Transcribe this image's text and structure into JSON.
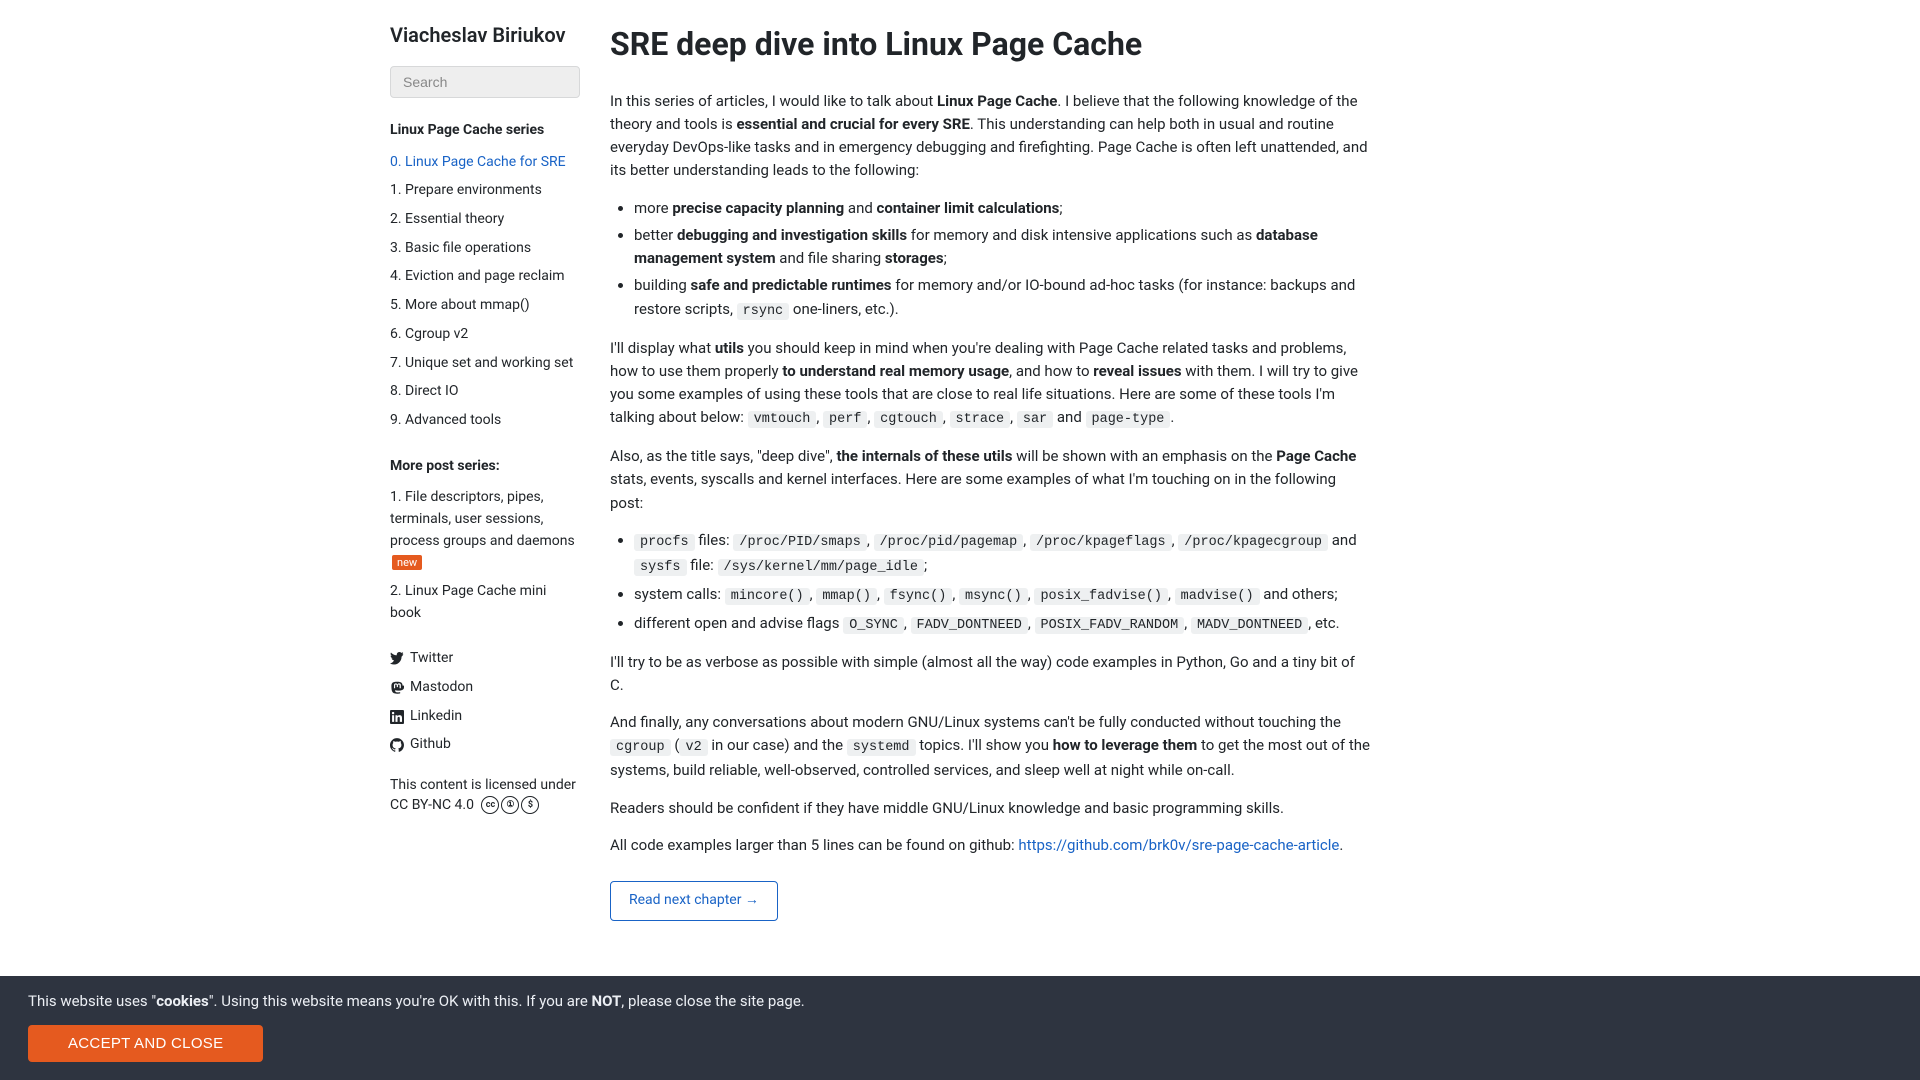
{
  "sidebar": {
    "brand": "Viacheslav Biriukov",
    "search_placeholder": "Search",
    "series_title": "Linux Page Cache series",
    "series": [
      "0. Linux Page Cache for SRE",
      "1. Prepare environments",
      "2. Essential theory",
      "3. Basic file operations",
      "4. Eviction and page reclaim",
      "5. More about mmap()",
      "6. Cgroup v2",
      "7. Unique set and working set",
      "8. Direct IO",
      "9. Advanced tools"
    ],
    "more_title": "More post series:",
    "more": [
      {
        "label": "1. File descriptors, pipes, terminals, user sessions, process groups and daemons",
        "badge": "new"
      },
      {
        "label": "2. Linux Page Cache mini book"
      }
    ],
    "social": [
      {
        "name": "twitter-icon",
        "label": "Twitter"
      },
      {
        "name": "mastodon-icon",
        "label": "Mastodon"
      },
      {
        "name": "linkedin-icon",
        "label": "Linkedin"
      },
      {
        "name": "github-icon",
        "label": "Github"
      }
    ],
    "license_line1": "This content is licensed under",
    "license_line2": "CC BY-NC 4.0"
  },
  "article": {
    "title": "SRE deep dive into Linux Page Cache",
    "p1a": "In this series of articles, I would like to talk about ",
    "p1b": "Linux Page Cache",
    "p1c": ". I believe that the following knowledge of the theory and tools is ",
    "p1d": "essential and crucial for every SRE",
    "p1e": ". This understanding can help both in usual and routine everyday DevOps-like tasks and in emergency debugging and firefighting. Page Cache is often left unattended, and its better understanding leads to the following:",
    "bullets1": {
      "a1": "more ",
      "a2": "precise capacity planning",
      "a3": " and ",
      "a4": "container limit calculations",
      "a5": ";",
      "b1": "better ",
      "b2": "debugging and investigation skills",
      "b3": " for memory and disk intensive applications such as ",
      "b4": "database management system",
      "b5": " and file sharing ",
      "b6": "storages",
      "b7": ";",
      "c1": "building ",
      "c2": "safe and predictable runtimes",
      "c3": " for memory and/or IO-bound ad-hoc tasks (for instance: backups and restore scripts, ",
      "c4": "rsync",
      "c5": " one-liners, etc.)."
    },
    "p2a": "I'll display what ",
    "p2b": "utils",
    "p2c": " you should keep in mind when you're dealing with Page Cache related tasks and problems, how to use them properly ",
    "p2d": "to understand real memory usage",
    "p2e": ", and how to ",
    "p2f": "reveal issues",
    "p2g": " with them. I will try to give you some examples of using these tools that are close to real life situations. Here are some of these tools I'm talking about below: ",
    "tools": [
      "vmtouch",
      "perf",
      "cgtouch",
      "strace",
      "sar",
      "page-type"
    ],
    "p2h": " and ",
    "p2i": ".",
    "p3a": "Also, as the title says, \"deep dive\", ",
    "p3b": "the internals of these utils",
    "p3c": " will be shown with an emphasis on the ",
    "p3d": "Page Cache",
    "p3e": " stats, events, syscalls and kernel interfaces. Here are some examples of what I'm touching on in the following post:",
    "bullets2": {
      "a1": "procfs",
      "a2": " files: ",
      "a3": "/proc/PID/smaps",
      "a4": "/proc/pid/pagemap",
      "a5": "/proc/kpageflags",
      "a6": "/proc/kpagecgroup",
      "a7": " and ",
      "a8": "sysfs",
      "a9": " file: ",
      "a10": "/sys/kernel/mm/page_idle",
      "a11": ";",
      "b1": "system calls: ",
      "b2": "mincore()",
      "b3": "mmap()",
      "b4": "fsync()",
      "b5": "msync()",
      "b6": "posix_fadvise()",
      "b7": "madvise()",
      "b8": " and others;",
      "c1": "different open and advise flags ",
      "c2": "O_SYNC",
      "c3": "FADV_DONTNEED",
      "c4": "POSIX_FADV_RANDOM",
      "c5": "MADV_DONTNEED",
      "c6": ", etc."
    },
    "p4": "I'll try to be as verbose as possible with simple (almost all the way) code examples in Python, Go and a tiny bit of C.",
    "p5a": "And finally, any conversations about modern GNU/Linux systems can't be fully conducted without touching the ",
    "p5b": "cgroup",
    "p5c": " (",
    "p5d": "v2",
    "p5e": " in our case) and the ",
    "p5f": "systemd",
    "p5g": " topics. I'll show you ",
    "p5h": "how to leverage them",
    "p5i": " to get the most out of the systems, build reliable, well-observed, controlled services, and sleep well at night while on-call.",
    "p6": "Readers should be confident if they have middle GNU/Linux knowledge and basic programming skills.",
    "p7a": "All code examples larger than 5 lines can be found on github: ",
    "p7b": "https://github.com/brk0v/sre-page-cache-article",
    "p7c": ".",
    "next": "Read next chapter →"
  },
  "cookie": {
    "t1": "This website uses \"",
    "t2": "cookies",
    "t3": "\". Using this website means you're OK with this. If you are ",
    "t4": "NOT",
    "t5": ", please close the site page.",
    "button": "ACCEPT AND CLOSE"
  }
}
